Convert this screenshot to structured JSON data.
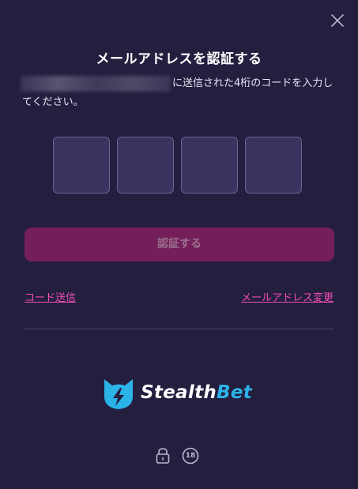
{
  "modal": {
    "close_icon": "close-icon",
    "title": "メールアドレスを認証する",
    "description_line1": "に送信された4桁のコードを入力し",
    "description_line2": "てください。",
    "code_digits": [
      "",
      "",
      "",
      ""
    ],
    "verify_button": "認証する",
    "resend_link": "コード送信",
    "change_email_link": "メールアドレス変更"
  },
  "brand": {
    "name_part1": "Stealth",
    "name_part2": "Bet",
    "logo_icon": "stealthbet-cat-logo"
  },
  "footer": {
    "lock_icon": "lock-icon",
    "age_badge": "18"
  },
  "colors": {
    "background": "#241e3f",
    "code_box": "#39335f",
    "button": "#751f5a",
    "link": "#f04fb4",
    "brand_accent": "#2bb3e8"
  }
}
